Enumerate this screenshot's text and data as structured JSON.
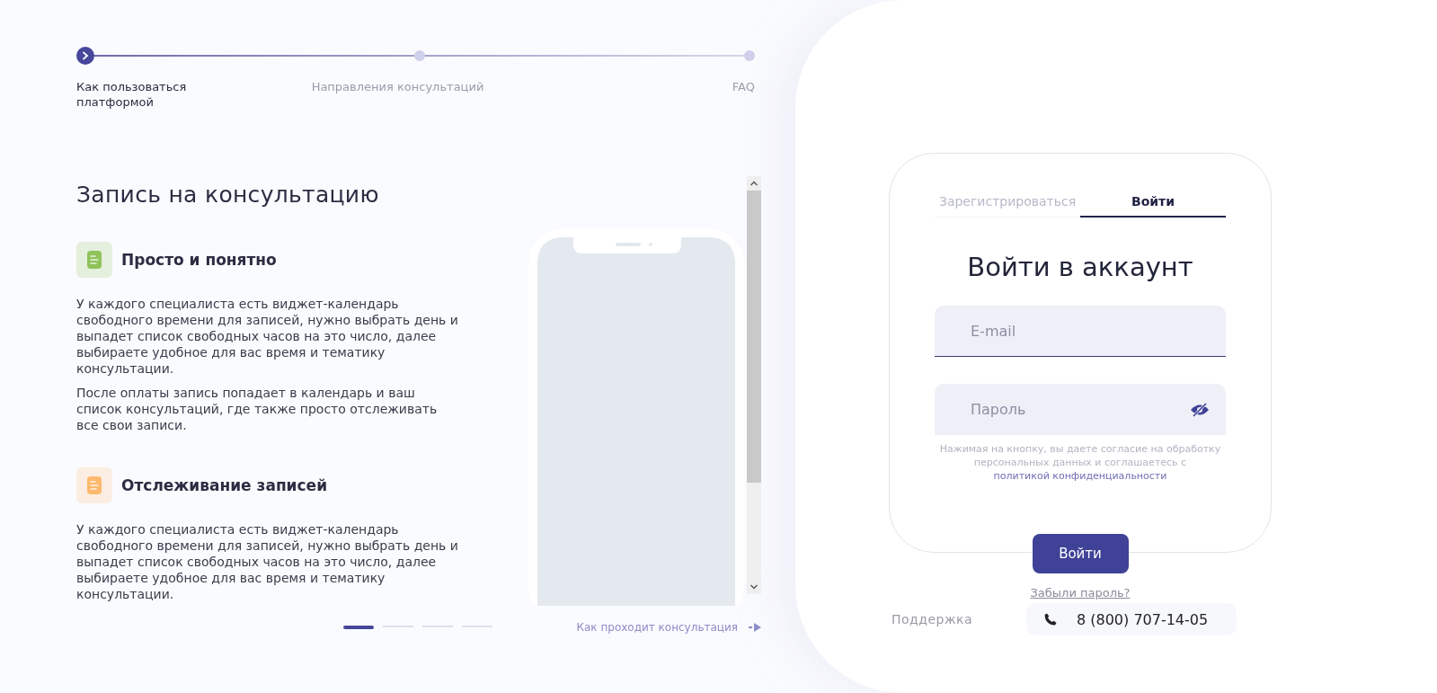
{
  "steps": [
    {
      "label": "Как пользоваться платформой",
      "selected": true
    },
    {
      "label": "Направления консультаций",
      "selected": false
    },
    {
      "label": "FAQ",
      "selected": false
    }
  ],
  "section_title": "Запись на консультацию",
  "features": [
    {
      "title": "Просто и понятно",
      "color": "#8fc35a",
      "paragraphs": [
        "У каждого специалиста есть виджет-календарь свободного времени для записей, нужно выбрать день и выпадет список свободных часов на это число, далее выбираете удобное для вас время и тематику консультации.",
        "После оплаты запись попадает в календарь и ваш список консультаций, где также просто отслеживать все свои записи."
      ]
    },
    {
      "title": "Отслеживание записей",
      "color": "#fdb96e",
      "paragraphs": [
        "У каждого специалиста есть виджет-календарь свободного времени для записей, нужно выбрать день и выпадет список свободных часов на это число, далее выбираете удобное для вас время и тематику консультации."
      ]
    }
  ],
  "carousel_dots": [
    {
      "selected": true
    },
    {
      "selected": false
    },
    {
      "selected": false
    },
    {
      "selected": false
    }
  ],
  "next_link": "Как проходит консультация",
  "login": {
    "tabs": [
      {
        "label": "Зарегистрироваться",
        "selected": false
      },
      {
        "label": "Войти",
        "selected": true
      }
    ],
    "title": "Войти в аккаунт",
    "email": {
      "placeholder": "E-mail"
    },
    "password": {
      "placeholder": "Пароль"
    },
    "consent": {
      "text": "Нажимая на кнопку, вы даете согласие на обработку персональных данных и соглашаетесь с",
      "link": "политикой конфиденциальности"
    },
    "submit": "Войти",
    "forgot": "Забыли пароль?"
  },
  "support": {
    "label": "Поддержка",
    "phone": "8 (800) 707-14-05"
  }
}
